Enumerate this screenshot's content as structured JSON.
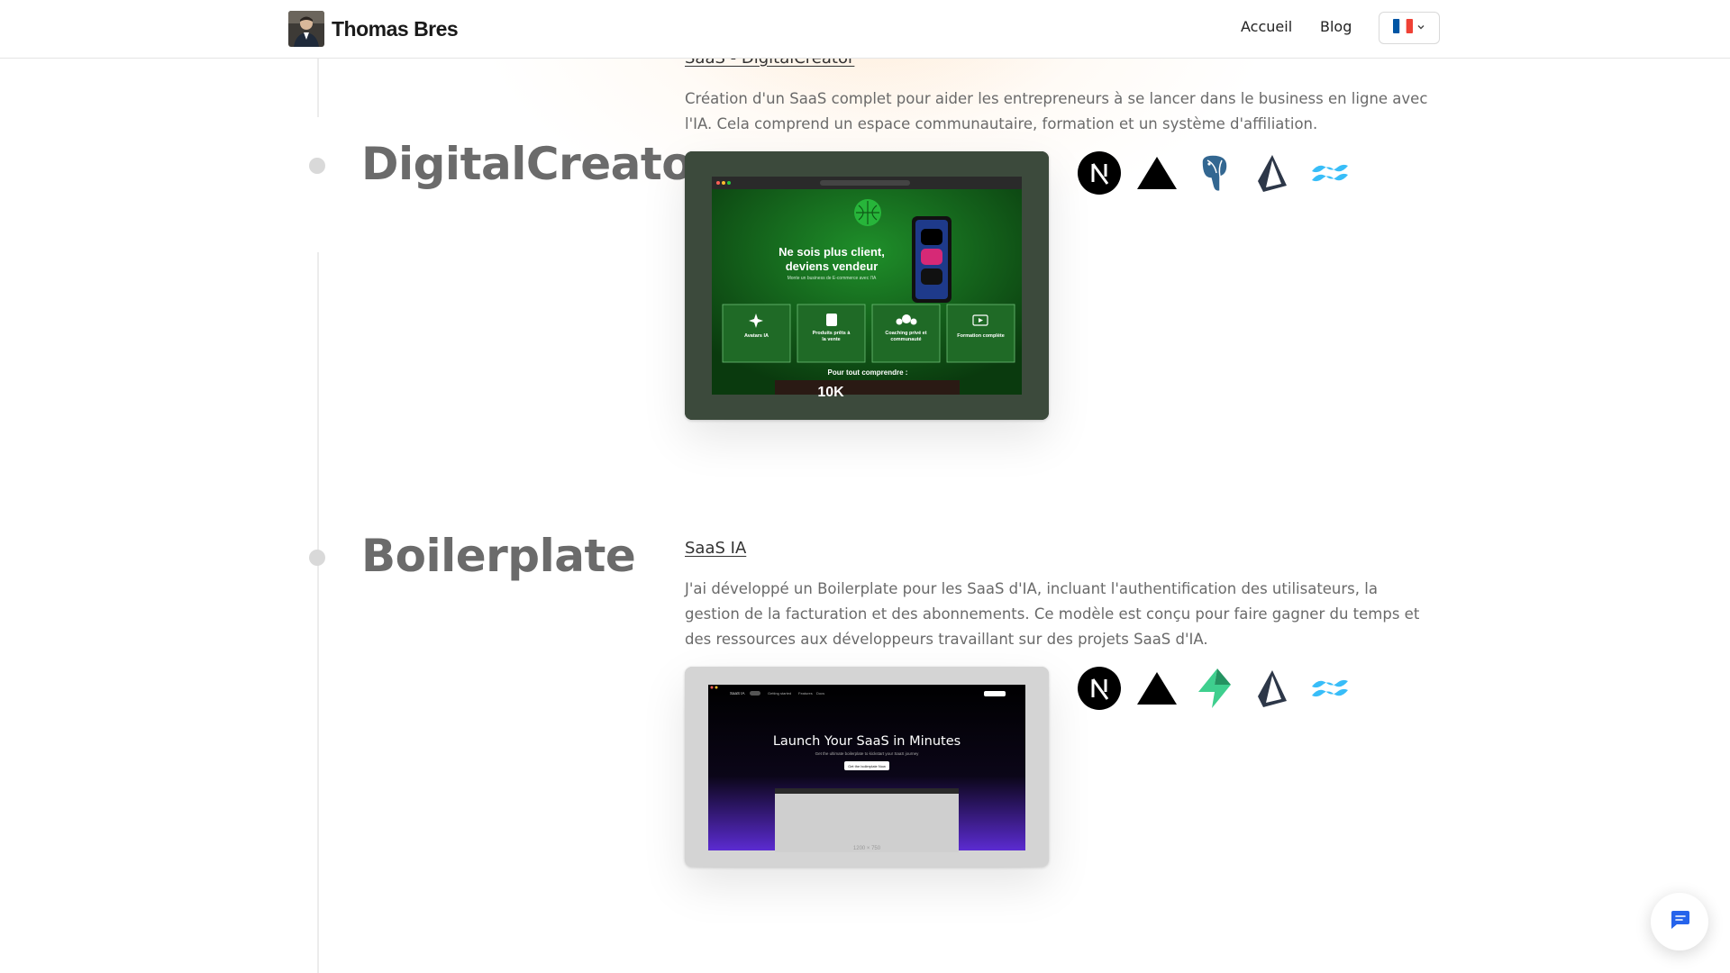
{
  "header": {
    "brand_name": "Thomas Bres",
    "nav": {
      "home": "Accueil",
      "blog": "Blog"
    },
    "language": {
      "selected_flag": "fr-flag-icon",
      "colors": [
        "#0055A4",
        "#FFFFFF",
        "#EF4135"
      ]
    }
  },
  "projects": [
    {
      "title": "DigitalCreator",
      "link_text": "SaaS - DigitalCreator",
      "description": "Création d'un SaaS complet pour aider les entrepreneurs à se lancer dans le business en ligne avec l'IA. Cela comprend un espace communautaire, formation et un système d'affiliation.",
      "preview": {
        "headline": "Ne sois plus client, deviens vendeur",
        "subheadline": "Monte un business de E-commerce avec l'IA",
        "features": [
          "Avatars IA",
          "Produits prêts à la vente",
          "Coaching privé et communauté",
          "Formation complète"
        ],
        "footer": "Pour tout comprendre :",
        "stat": "10K"
      },
      "tech": [
        "nextjs-icon",
        "vercel-icon",
        "postgresql-icon",
        "prisma-icon",
        "tailwind-icon"
      ]
    },
    {
      "title": "Boilerplate",
      "link_text": "SaaS IA",
      "description": "J'ai développé un Boilerplate pour les SaaS d'IA, incluant l'authentification des utilisateurs, la gestion de la facturation et des abonnements. Ce modèle est conçu pour faire gagner du temps et des ressources aux développeurs travaillant sur des projets SaaS d'IA.",
      "preview": {
        "headline": "Launch Your SaaS in Minutes",
        "subheadline": "Get the ultimate boilerplate to kickstart your SaaS journey",
        "cta": "Get the boilerplate Now",
        "nav_brand": "SaaS IA",
        "placeholder": "1200 × 750"
      },
      "tech": [
        "nextjs-icon",
        "vercel-icon",
        "supabase-icon",
        "prisma-icon",
        "tailwind-icon"
      ]
    }
  ],
  "colors": {
    "title_gray": "#6b6b6b",
    "text_gray": "#6a6a6a",
    "digitalcreator_green": "#0a7a1c",
    "boilerplate_purple": "#5b2bd1",
    "chat_blue": "#2563eb"
  },
  "chat": {
    "icon": "chat-bubble-icon"
  }
}
